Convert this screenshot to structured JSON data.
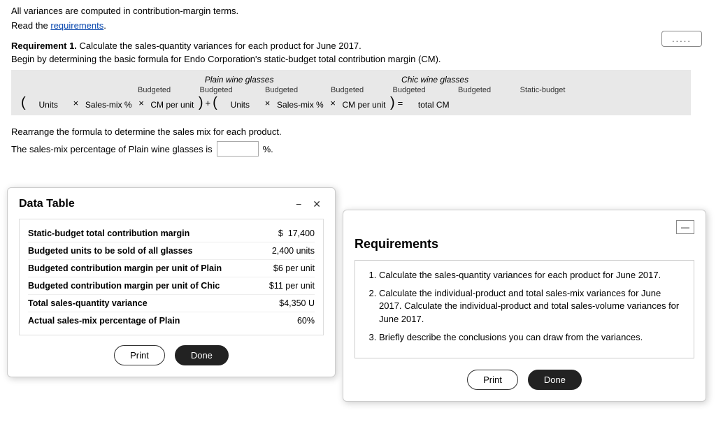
{
  "page": {
    "note": "All variances are computed in contribution-margin terms.",
    "read_text": "Read the ",
    "requirements_link": "requirements",
    "read_period": ".",
    "dotted_button": ".....",
    "requirement1_bold": "Requirement 1.",
    "requirement1_text": " Calculate the sales-quantity variances for each product for June 2017.",
    "begin_text": "Begin by determining the basic formula for Endo Corporation's static-budget total contribution margin (CM).",
    "formula": {
      "plain_header": "Plain wine glasses",
      "chic_header": "Chic wine glasses",
      "row": [
        {
          "top": "Budgeted",
          "bot": "Units"
        },
        {
          "top": "Budgeted",
          "bot": "Sales-mix %"
        },
        {
          "top": "Budgeted",
          "bot": "CM per unit"
        },
        {
          "top": "Budgeted",
          "bot": "Units"
        },
        {
          "top": "Budgeted",
          "bot": "Sales-mix %"
        },
        {
          "top": "Budgeted",
          "bot": "CM per unit"
        },
        {
          "top": "Static-budget",
          "bot": "total CM"
        }
      ]
    },
    "rearrange_text": "Rearrange the formula to determine the sales mix for each product.",
    "sales_mix_label": "The sales-mix percentage of Plain wine glasses is",
    "sales_mix_suffix": "%.",
    "sales_mix_value": ""
  },
  "data_table_modal": {
    "title": "Data Table",
    "rows": [
      {
        "label": "Static-budget total contribution margin",
        "value": "$",
        "value2": "17,400"
      },
      {
        "label": "Budgeted units to be sold of all glasses",
        "value": "",
        "value2": "2,400 units"
      },
      {
        "label": "Budgeted contribution margin per unit of Plain",
        "value": "",
        "value2": "$6 per unit"
      },
      {
        "label": "Budgeted contribution margin per unit of Chic",
        "value": "",
        "value2": "$11 per unit"
      },
      {
        "label": "Total sales-quantity variance",
        "value": "",
        "value2": "$4,350 U"
      },
      {
        "label": "Actual sales-mix percentage of Plain",
        "value": "",
        "value2": "60%"
      }
    ],
    "print_label": "Print",
    "done_label": "Done",
    "minimize": "−",
    "close": "✕"
  },
  "requirements_modal": {
    "title": "Requirements",
    "items": [
      "Calculate the sales-quantity variances for each product for June 2017.",
      "Calculate the individual-product and total sales-mix variances for June 2017. Calculate the individual-product and total sales-volume variances for June 2017.",
      "Briefly describe the conclusions you can draw from the variances."
    ],
    "print_label": "Print",
    "done_label": "Done",
    "collapse": "—"
  }
}
